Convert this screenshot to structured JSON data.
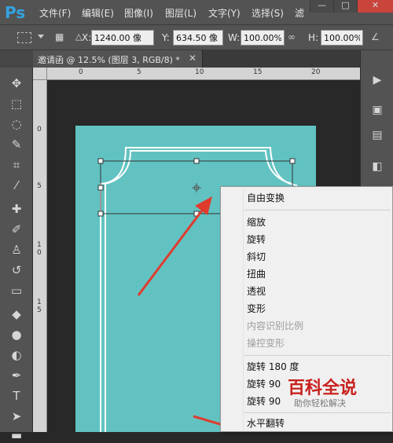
{
  "app": {
    "logo": "Ps"
  },
  "menu": {
    "items": [
      "文件(F)",
      "编辑(E)",
      "图像(I)",
      "图层(L)",
      "文字(Y)",
      "选择(S)",
      "滤"
    ]
  },
  "window_controls": {
    "minimize": "—",
    "restore": "□",
    "close": "✕"
  },
  "options": {
    "x_label": "X:",
    "x_value": "1240.00 像",
    "y_label": "Y:",
    "y_value": "634.50 像",
    "w_label": "W:",
    "w_value": "100.00%",
    "h_label": "H:",
    "h_value": "100.00%"
  },
  "document": {
    "tab_title": "邀请函 @ 12.5% (图层 3, RGB/8) *",
    "tab_close": "✕",
    "canvas_color": "#62c2c2"
  },
  "ruler": {
    "top_ticks": [
      "0",
      "5",
      "10",
      "15",
      "20"
    ],
    "left_ticks": [
      "0",
      "5",
      "1 0",
      "1 5"
    ]
  },
  "tools": [
    "move-tool",
    "marquee-tool",
    "lasso-tool",
    "quick-select-tool",
    "crop-tool",
    "eyedropper-tool",
    "healing-brush-tool",
    "brush-tool",
    "clone-stamp-tool",
    "history-brush-tool",
    "eraser-tool",
    "paint-bucket-tool",
    "dodge-tool",
    "pen-tool",
    "type-tool",
    "path-select-tool",
    "rectangle-tool"
  ],
  "context_menu": {
    "free_transform": "自由变换",
    "scale": "缩放",
    "rotate": "旋转",
    "skew": "斜切",
    "distort": "扭曲",
    "perspective": "透视",
    "warp": "变形",
    "content_aware_scale": "内容识别比例",
    "puppet_warp": "操控变形",
    "rotate_180": "旋转 180 度",
    "rotate_90_cw": "旋转 90",
    "rotate_90_ccw": "旋转 90",
    "flip_horizontal": "水平翻转"
  },
  "watermark": {
    "title": "百科全说",
    "subtitle": "助你轻松解决"
  },
  "colors": {
    "arrow": "#e03c2e",
    "accent": "#34a3e0"
  }
}
